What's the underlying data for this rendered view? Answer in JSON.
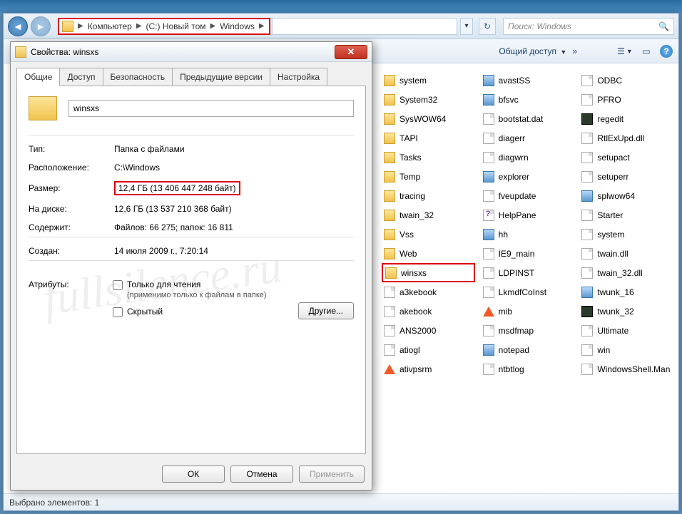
{
  "breadcrumb": {
    "segs": [
      "Компьютер",
      "(C:) Новый том",
      "Windows"
    ]
  },
  "search": {
    "placeholder": "Поиск: Windows"
  },
  "toolbar": {
    "share": "Общий доступ"
  },
  "columns": [
    [
      {
        "icon": "folder",
        "name": "system"
      },
      {
        "icon": "folder",
        "name": "System32"
      },
      {
        "icon": "folder",
        "name": "SysWOW64"
      },
      {
        "icon": "folder",
        "name": "TAPI"
      },
      {
        "icon": "folder",
        "name": "Tasks"
      },
      {
        "icon": "folder",
        "name": "Temp"
      },
      {
        "icon": "folder",
        "name": "tracing"
      },
      {
        "icon": "folder",
        "name": "twain_32"
      },
      {
        "icon": "folder",
        "name": "Vss"
      },
      {
        "icon": "folder",
        "name": "Web"
      },
      {
        "icon": "folder",
        "name": "winsxs",
        "hl": true
      },
      {
        "icon": "file",
        "name": "a3kebook"
      },
      {
        "icon": "file",
        "name": "akebook"
      },
      {
        "icon": "file",
        "name": "ANS2000"
      },
      {
        "icon": "file",
        "name": "atiogl"
      },
      {
        "icon": "vlc",
        "name": "ativpsrm"
      }
    ],
    [
      {
        "icon": "exe",
        "name": "avastSS"
      },
      {
        "icon": "exe",
        "name": "bfsvc"
      },
      {
        "icon": "file",
        "name": "bootstat.dat"
      },
      {
        "icon": "file",
        "name": "diagerr"
      },
      {
        "icon": "file",
        "name": "diagwrn"
      },
      {
        "icon": "exe",
        "name": "explorer"
      },
      {
        "icon": "file",
        "name": "fveupdate"
      },
      {
        "icon": "chm",
        "name": "HelpPane"
      },
      {
        "icon": "exe",
        "name": "hh"
      },
      {
        "icon": "file",
        "name": "IE9_main"
      },
      {
        "icon": "file",
        "name": "LDPINST"
      },
      {
        "icon": "file",
        "name": "LkmdfCoInst"
      },
      {
        "icon": "vlc",
        "name": "mib"
      },
      {
        "icon": "file",
        "name": "msdfmap"
      },
      {
        "icon": "exe",
        "name": "notepad"
      },
      {
        "icon": "file",
        "name": "ntbtlog"
      }
    ],
    [
      {
        "icon": "file",
        "name": "ODBC"
      },
      {
        "icon": "file",
        "name": "PFRO"
      },
      {
        "icon": "dark",
        "name": "regedit"
      },
      {
        "icon": "file",
        "name": "RtlExUpd.dll"
      },
      {
        "icon": "file",
        "name": "setupact"
      },
      {
        "icon": "file",
        "name": "setuperr"
      },
      {
        "icon": "exe",
        "name": "splwow64"
      },
      {
        "icon": "file",
        "name": "Starter"
      },
      {
        "icon": "file",
        "name": "system"
      },
      {
        "icon": "file",
        "name": "twain.dll"
      },
      {
        "icon": "file",
        "name": "twain_32.dll"
      },
      {
        "icon": "exe",
        "name": "twunk_16"
      },
      {
        "icon": "dark",
        "name": "twunk_32"
      },
      {
        "icon": "file",
        "name": "Ultimate"
      },
      {
        "icon": "file",
        "name": "win"
      },
      {
        "icon": "file",
        "name": "WindowsShell.Man"
      }
    ]
  ],
  "status": {
    "text": "Выбрано элементов: 1"
  },
  "props": {
    "title": "Свойства: winsxs",
    "tabs": [
      "Общие",
      "Доступ",
      "Безопасность",
      "Предыдущие версии",
      "Настройка"
    ],
    "name": "winsxs",
    "rows": {
      "type_l": "Тип:",
      "type_v": "Папка с файлами",
      "loc_l": "Расположение:",
      "loc_v": "C:\\Windows",
      "size_l": "Размер:",
      "size_v": "12,4 ГБ (13 406 447 248 байт)",
      "disk_l": "На диске:",
      "disk_v": "12,6 ГБ (13 537 210 368 байт)",
      "cont_l": "Содержит:",
      "cont_v": "Файлов: 66 275; папок: 16 811",
      "created_l": "Создан:",
      "created_v": "14 июля 2009 г., 7:20:14",
      "attr_l": "Атрибуты:"
    },
    "readonly": "Только для чтения",
    "readonly_sub": "(применимо только к файлам в папке)",
    "hidden": "Скрытый",
    "other_btn": "Другие...",
    "ok": "ОК",
    "cancel": "Отмена",
    "apply": "Применить"
  },
  "watermark": "fullsilence.ru"
}
